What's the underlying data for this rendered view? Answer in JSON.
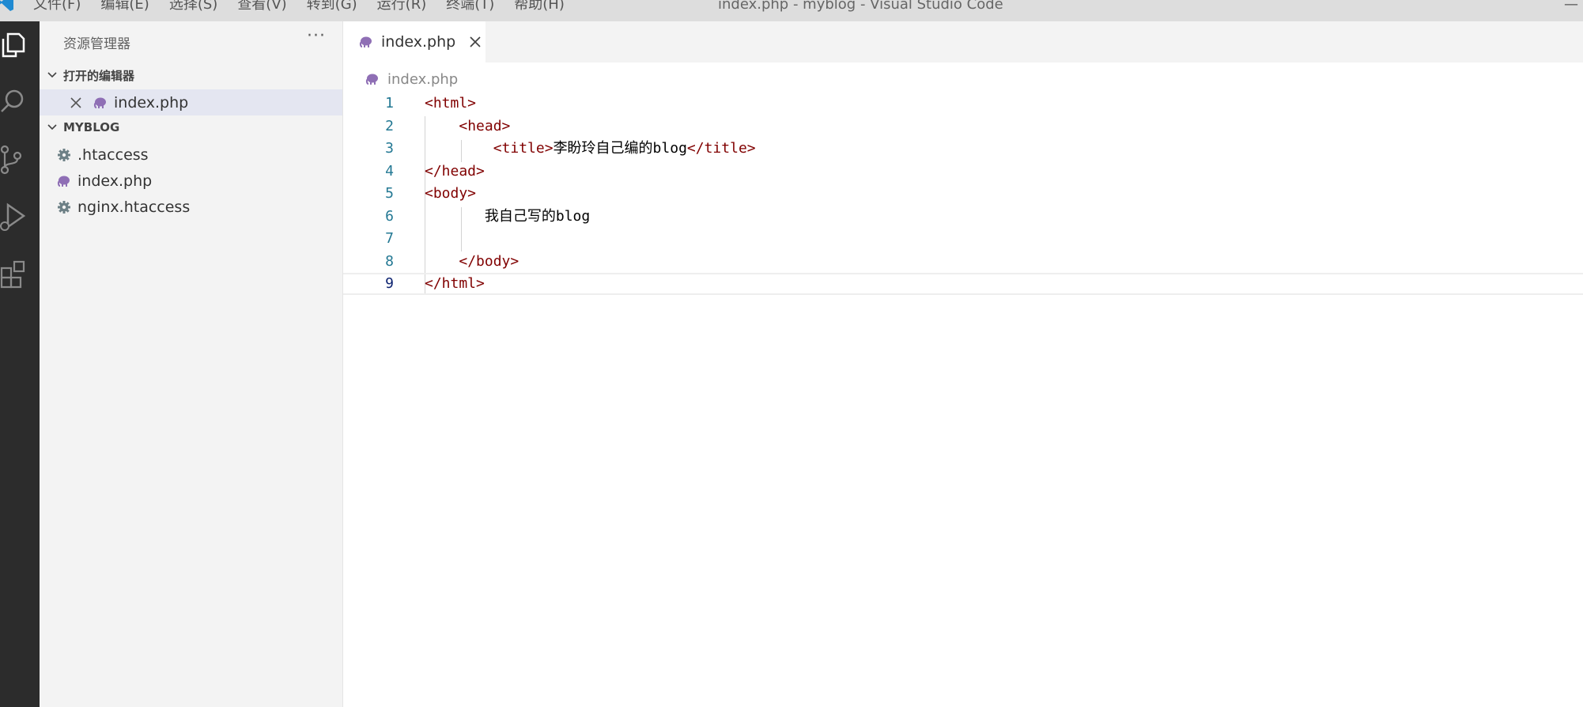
{
  "titlebar": {
    "menu": [
      "文件(F)",
      "编辑(E)",
      "选择(S)",
      "查看(V)",
      "转到(G)",
      "运行(R)",
      "终端(T)",
      "帮助(H)"
    ],
    "window_title": "index.php - myblog - Visual Studio Code",
    "minimize_glyph": "—"
  },
  "sidebar": {
    "title": "资源管理器",
    "more_glyph": "···",
    "open_editors": {
      "header": "打开的编辑器",
      "files": [
        {
          "name": "index.php",
          "icon": "php-elephant-icon"
        }
      ]
    },
    "folder": {
      "header": "MYBLOG",
      "files": [
        {
          "name": ".htaccess",
          "icon": "gear-icon"
        },
        {
          "name": "index.php",
          "icon": "php-elephant-icon"
        },
        {
          "name": "nginx.htaccess",
          "icon": "gear-icon"
        }
      ]
    }
  },
  "editor": {
    "tab": {
      "label": "index.php"
    },
    "breadcrumb": "index.php",
    "current_line": 9,
    "lines": [
      {
        "num": "1",
        "parts": [
          [
            "tag",
            "<html>"
          ]
        ]
      },
      {
        "num": "2",
        "parts": [
          [
            "txt",
            "    "
          ],
          [
            "tag",
            "<head>"
          ]
        ]
      },
      {
        "num": "3",
        "parts": [
          [
            "txt",
            "        "
          ],
          [
            "tag",
            "<title>"
          ],
          [
            "txt",
            "李盼玲自己编的blog"
          ],
          [
            "tag",
            "</title>"
          ]
        ]
      },
      {
        "num": "4",
        "parts": [
          [
            "tag",
            "</head>"
          ]
        ]
      },
      {
        "num": "5",
        "parts": [
          [
            "tag",
            "<body>"
          ]
        ]
      },
      {
        "num": "6",
        "parts": [
          [
            "txt",
            "       我自己写的blog"
          ]
        ]
      },
      {
        "num": "7",
        "parts": [
          [
            "txt",
            ""
          ]
        ]
      },
      {
        "num": "8",
        "parts": [
          [
            "txt",
            "    "
          ],
          [
            "tag",
            "</body>"
          ]
        ]
      },
      {
        "num": "9",
        "parts": [
          [
            "tag",
            "</html>"
          ]
        ]
      }
    ]
  },
  "colors": {
    "activity_bar": "#2c2c2c",
    "sidebar_bg": "#f3f3f3",
    "tag": "#800000",
    "line_number": "#237893",
    "php_icon": "#8f6fb5"
  }
}
